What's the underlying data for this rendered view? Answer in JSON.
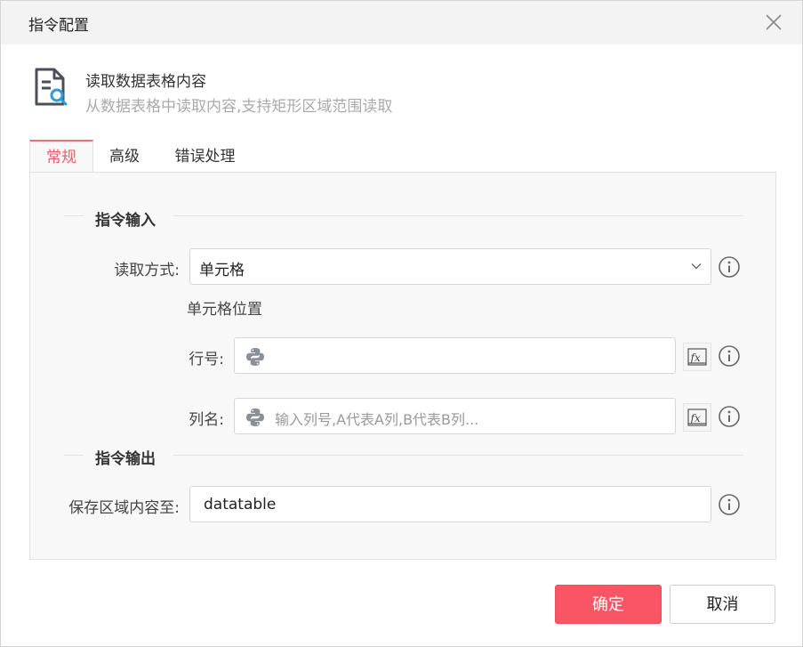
{
  "window": {
    "title": "指令配置"
  },
  "header": {
    "title": "读取数据表格内容",
    "description": "从数据表格中读取内容,支持矩形区域范围读取"
  },
  "tabs": [
    {
      "label": "常规",
      "active": true
    },
    {
      "label": "高级",
      "active": false
    },
    {
      "label": "错误处理",
      "active": false
    }
  ],
  "input_section": {
    "title": "指令输入",
    "read_mode": {
      "label": "读取方式:",
      "value": "单元格"
    },
    "cell_position_label": "单元格位置",
    "row": {
      "label": "行号:",
      "value": "",
      "placeholder": ""
    },
    "column": {
      "label": "列名:",
      "value": "",
      "placeholder": "输入列号,A代表A列,B代表B列..."
    }
  },
  "output_section": {
    "title": "指令输出",
    "save_to": {
      "label": "保存区域内容至:",
      "value": "datatable"
    }
  },
  "footer": {
    "ok_label": "确定",
    "cancel_label": "取消"
  },
  "colors": {
    "accent": "#fa5565",
    "tab_active": "#f05a6a",
    "info_icon": "#666666"
  }
}
